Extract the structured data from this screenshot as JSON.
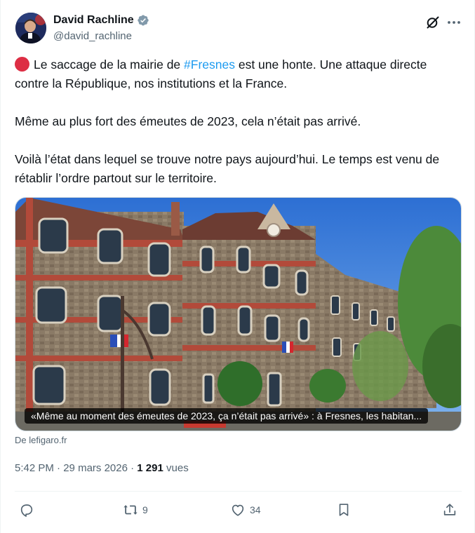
{
  "author": {
    "name": "David Rachline",
    "handle": "@david_rachline",
    "verified_color": "#829aab"
  },
  "tweet": {
    "para1_before": "Le saccage de la mairie de ",
    "para1_hashtag": "#Fresnes",
    "para1_after": " est une honte. Une attaque directe contre la République, nos institutions et la France.",
    "para2": "Même au plus fort des émeutes de 2023, cela n’était pas arrivé.",
    "para3": "Voilà l’état dans lequel se trouve notre pays aujourd’hui. Le temps est venu de rétablir l’ordre partout sur le territoire.",
    "emoji": "red-circle"
  },
  "card": {
    "caption": "«Même au moment des émeutes de 2023, ça n’était pas arrivé» : à Fresnes, les habitan...",
    "source": "De lefigaro.fr"
  },
  "meta": {
    "time": "5:42 PM",
    "sep1": " · ",
    "date": "29 mars 2026",
    "sep2": " · ",
    "views_count": "1 291",
    "views_label": " vues"
  },
  "actions": {
    "reply_count": "",
    "retweet_count": "9",
    "like_count": "34"
  },
  "icons": {
    "grok": "grok-icon",
    "more": "more-icon",
    "reply": "reply-icon",
    "retweet": "retweet-icon",
    "like": "heart-icon",
    "bookmark": "bookmark-icon",
    "share": "share-icon"
  },
  "colors": {
    "accent": "#1d9bf0",
    "secondary_text": "#536471",
    "emoji_red": "#dd2e44"
  }
}
